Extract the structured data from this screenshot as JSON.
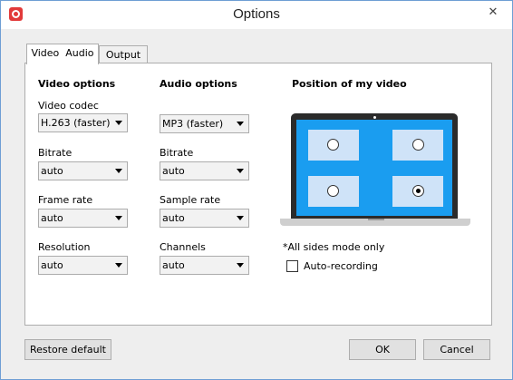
{
  "window": {
    "title": "Options"
  },
  "tabs": [
    {
      "label": "Video  Audio",
      "active": true
    },
    {
      "label": "Output",
      "active": false
    }
  ],
  "video_options": {
    "title": "Video options",
    "codec_label": "Video codec",
    "codec_value": "H.263 (faster)",
    "bitrate_label": "Bitrate",
    "bitrate_value": "auto",
    "framerate_label": "Frame rate",
    "framerate_value": "auto",
    "resolution_label": "Resolution",
    "resolution_value": "auto"
  },
  "audio_options": {
    "title": "Audio options",
    "format_value": "MP3 (faster)",
    "bitrate_label": "Bitrate",
    "bitrate_value": "auto",
    "samplerate_label": "Sample rate",
    "samplerate_value": "auto",
    "channels_label": "Channels",
    "channels_value": "auto"
  },
  "position": {
    "title": "Position of my video",
    "selected": "bottom-right",
    "note": "*All sides mode only",
    "auto_recording_label": "Auto-recording",
    "auto_recording_checked": false
  },
  "buttons": {
    "restore": "Restore default",
    "ok": "OK",
    "cancel": "Cancel"
  },
  "colors": {
    "accent": "#1a9df0",
    "position_box": "#cfe3f8",
    "brand": "#e23a3a"
  }
}
